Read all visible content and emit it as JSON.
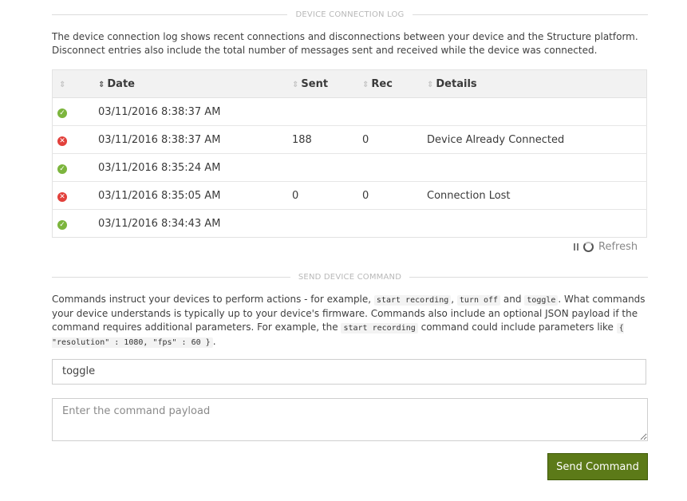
{
  "log_section": {
    "title": "DEVICE CONNECTION LOG",
    "description": "The device connection log shows recent connections and disconnections between your device and the Structure platform. Disconnect entries also include the total number of messages sent and received while the device was connected."
  },
  "table": {
    "headers": {
      "date": "Date",
      "sent": "Sent",
      "rec": "Rec",
      "details": "Details"
    },
    "rows": [
      {
        "status": "connected",
        "date": "03/11/2016 8:38:37 AM",
        "sent": "",
        "rec": "",
        "details": ""
      },
      {
        "status": "disconnected",
        "date": "03/11/2016 8:38:37 AM",
        "sent": "188",
        "rec": "0",
        "details": "Device Already Connected"
      },
      {
        "status": "connected",
        "date": "03/11/2016 8:35:24 AM",
        "sent": "",
        "rec": "",
        "details": ""
      },
      {
        "status": "disconnected",
        "date": "03/11/2016 8:35:05 AM",
        "sent": "0",
        "rec": "0",
        "details": "Connection Lost"
      },
      {
        "status": "connected",
        "date": "03/11/2016 8:34:43 AM",
        "sent": "",
        "rec": "",
        "details": ""
      }
    ]
  },
  "refresh": {
    "label": "Refresh"
  },
  "command_section": {
    "title": "SEND DEVICE COMMAND",
    "desc_1": "Commands instruct your devices to perform actions - for example,",
    "code_1": "start recording",
    "desc_2": ",",
    "code_2": "turn off",
    "desc_3": "and",
    "code_3": "toggle",
    "desc_4": ". What commands your device understands is typically up to your device's firmware. Commands also include an optional JSON payload if the command requires additional parameters. For example, the",
    "code_4": "start recording",
    "desc_5": "command could include parameters like",
    "code_5": "{ \"resolution\" : 1080, \"fps\" : 60 }",
    "desc_6": "."
  },
  "command_input": {
    "value": "toggle"
  },
  "payload_input": {
    "placeholder": "Enter the command payload"
  },
  "send_button": {
    "label": "Send Command"
  },
  "colors": {
    "ok": "#7cb53d",
    "error": "#e2403b",
    "button": "#5c7a18"
  }
}
